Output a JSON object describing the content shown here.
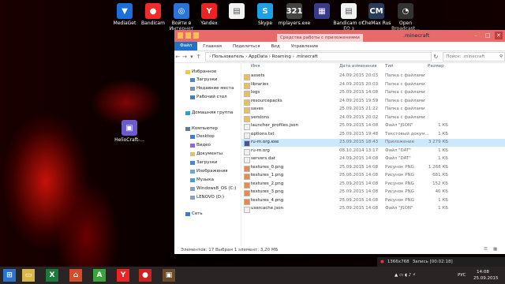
{
  "desktop": {
    "icons": [
      {
        "label": "MediaGet",
        "color": "#1a6fd8",
        "glyph": "▼"
      },
      {
        "label": "Bandicam",
        "color": "#ef2b2b",
        "glyph": "●"
      },
      {
        "label": "Войти в Интернет",
        "color": "#2b73d8",
        "glyph": "◎"
      },
      {
        "label": "Yandex",
        "color": "#e22",
        "glyph": "Y"
      },
      {
        "label": "",
        "color": "#f2f2f2",
        "glyph": "▤"
      },
      {
        "label": "Skype",
        "color": "#1da1e4",
        "glyph": "S"
      },
      {
        "label": "mplayers.exe",
        "color": "#444",
        "glyph": "321"
      },
      {
        "label": "",
        "color": "#3a3a8a",
        "glyph": "▦"
      },
      {
        "label": "Bandicam от EO з",
        "color": "#f2f2f2",
        "glyph": "▤"
      },
      {
        "label": "CheMax Rus",
        "color": "#2a3a5a",
        "glyph": "CM"
      },
      {
        "label": "Open Broadcast...",
        "color": "#333",
        "glyph": "◔"
      }
    ],
    "side_icon": {
      "label": "HelioCraft-...",
      "glyph": "▣"
    }
  },
  "window": {
    "title": ".minecraft",
    "contextual_tab": "Средства работы с приложениями",
    "ribbon_tabs": [
      "Файл",
      "Главная",
      "Поделиться",
      "Вид",
      "Управление"
    ],
    "address_path": "›  Пользователь  ›  AppData  ›  Roaming  ›  .minecraft",
    "search_placeholder": "Поиск: .minecraft",
    "nav": {
      "favorites": "Избранное",
      "downloads": "Загрузки",
      "recent": "Недавние места",
      "desktop_fav": "Рабочий стол",
      "homegroup": "Домашняя группа",
      "computer": "Компьютер",
      "desktop": "Desktop",
      "video": "Видео",
      "documents": "Документы",
      "downloads2": "Загрузки",
      "pictures": "Изображения",
      "music": "Музыка",
      "drive_c": "Windows8_OS (C:)",
      "drive_d": "LENOVO (D:)",
      "network": "Сеть"
    },
    "columns": {
      "name": "Имя",
      "date": "Дата изменения",
      "type": "Тип",
      "size": "Размер"
    },
    "files": [
      {
        "name": "assets",
        "date": "24.09.2015 20:03",
        "type": "Папка с файлами",
        "size": "",
        "kind": "folder"
      },
      {
        "name": "libraries",
        "date": "24.09.2015 20:03",
        "type": "Папка с файлами",
        "size": "",
        "kind": "folder"
      },
      {
        "name": "logs",
        "date": "25.09.2015 14:08",
        "type": "Папка с файлами",
        "size": "",
        "kind": "folder"
      },
      {
        "name": "resourcepacks",
        "date": "24.09.2015 19:59",
        "type": "Папка с файлами",
        "size": "",
        "kind": "folder"
      },
      {
        "name": "saves",
        "date": "25.09.2015 21:22",
        "type": "Папка с файлами",
        "size": "",
        "kind": "folder"
      },
      {
        "name": "versions",
        "date": "24.09.2015 20:02",
        "type": "Папка с файлами",
        "size": "",
        "kind": "folder"
      },
      {
        "name": "launcher_profiles.json",
        "date": "25.09.2015 14:08",
        "type": "Файл \"JSON\"",
        "size": "1 КБ",
        "kind": "file"
      },
      {
        "name": "options.txt",
        "date": "25.09.2015 19:48",
        "type": "Текстовый докум...",
        "size": "1 КБ",
        "kind": "file"
      },
      {
        "name": "ru-m.org.exe",
        "date": "23.09.2015 18:43",
        "type": "Приложение",
        "size": "3 279 КБ",
        "kind": "exe",
        "selected": true
      },
      {
        "name": "ru-m.org",
        "date": "08.10.2014 13:17",
        "type": "Файл \"DAT\"",
        "size": "1 КБ",
        "kind": "file"
      },
      {
        "name": "servers.dat",
        "date": "24.09.2015 14:08",
        "type": "Файл \"DAT\"",
        "size": "1 КБ",
        "kind": "file"
      },
      {
        "name": "textures_0.png",
        "date": "25.09.2015 14:08",
        "type": "Рисунок PNG",
        "size": "1 268 КБ",
        "kind": "png"
      },
      {
        "name": "textures_1.png",
        "date": "25.06.2015 14:08",
        "type": "Рисунок PNG",
        "size": "681 КБ",
        "kind": "png"
      },
      {
        "name": "textures_2.png",
        "date": "25.09.2015 14:08",
        "type": "Рисунок PNG",
        "size": "152 КБ",
        "kind": "png"
      },
      {
        "name": "textures_3.png",
        "date": "25.09.2015 14:08",
        "type": "Рисунок PNG",
        "size": "40 КБ",
        "kind": "png"
      },
      {
        "name": "textures_4.png",
        "date": "25.09.2015 14:08",
        "type": "Рисунок PNG",
        "size": "1 КБ",
        "kind": "png"
      },
      {
        "name": "usercache.json",
        "date": "25.09.2015 14:08",
        "type": "Файл \"JSON\"",
        "size": "1 КБ",
        "kind": "file"
      }
    ],
    "status": "Элементов: 17    Выбран 1 элемент: 3,20 МБ"
  },
  "recording": {
    "res": "1366x768",
    "label": "Запись [00:02:18]"
  },
  "taskbar": {
    "lang": "РУС",
    "time": "14:08",
    "date": "25.09.2015"
  },
  "colors": {
    "titlebar": "#e86a6a",
    "file_tab": "#1e73c8",
    "selection": "#cce8ff"
  }
}
